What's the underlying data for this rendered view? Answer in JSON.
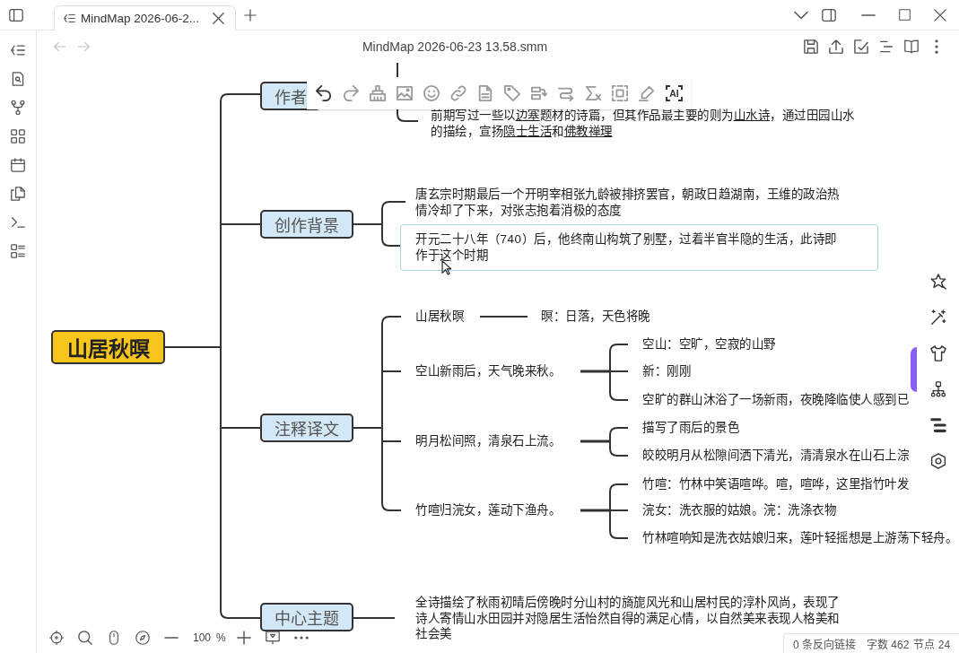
{
  "window": {
    "tabs": [
      {
        "title": "MindMap 2026-06-2...",
        "selected": true
      }
    ],
    "navigation": [
      {
        "kind": "back",
        "disabled": true
      },
      {
        "kind": "forward",
        "disabled": true
      }
    ],
    "document_title": "MindMap 2026-06-23 13.58.smm"
  },
  "mindmap": {
    "root": {
      "text": "山居秋暝",
      "children": [
        {
          "text": "作者",
          "children": [
            {
              "segments": [
                {
                  "text": "前期写过一些以",
                  "underlined": false
                },
                {
                  "text": "边塞",
                  "underlined": true
                },
                {
                  "text": "题材的诗篇，但其作品最主要的则为",
                  "underlined": false
                },
                {
                  "text": "山水诗",
                  "underlined": true
                },
                {
                  "text": "，通过田园山水的描绘，宣扬",
                  "underlined": false
                },
                {
                  "text": "隐士生活",
                  "underlined": true
                },
                {
                  "text": "和",
                  "underlined": false
                },
                {
                  "text": "佛教禅理",
                  "underlined": true
                }
              ]
            }
          ]
        },
        {
          "text": "创作背景",
          "children": [
            {
              "text": "唐玄宗时期最后一个开明宰相张九龄被排挤罢官，朝政日趋湖南，王维的政治热情冷却了下来，对张志抱着消极的态度",
              "hovered": false
            },
            {
              "text": "开元二十八年（740）后，他终南山构筑了别墅，过着半官半隐的生活，此诗即作于这个时期",
              "hovered": true
            }
          ]
        },
        {
          "text": "注释译文",
          "children": [
            {
              "text": "山居秋暝",
              "children": [
                {
                  "text": "暝：日落，天色将晚"
                }
              ]
            },
            {
              "text": "空山新雨后，天气晚来秋。",
              "children": [
                {
                  "text": "空山：空旷，空寂的山野"
                },
                {
                  "text": "新：刚刚"
                },
                {
                  "text": "空旷的群山沐浴了一场新雨，夜晚降临使人感到已"
                }
              ]
            },
            {
              "text": "明月松间照，清泉石上流。",
              "children": [
                {
                  "text": "描写了雨后的景色"
                },
                {
                  "text": "皎皎明月从松隙间洒下清光，清清泉水在山石上淙"
                }
              ]
            },
            {
              "text": "竹喧归浣女，莲动下渔舟。",
              "children": [
                {
                  "text": "竹喧：竹林中笑语喧哗。喧，喧哗，这里指竹叶发"
                },
                {
                  "text": "浣女：洗衣服的姑娘。浣：洗涤衣物"
                },
                {
                  "text": "竹林喧响知是洗衣姑娘归来，莲叶轻摇想是上游荡下轻舟。"
                }
              ]
            }
          ]
        },
        {
          "text": "中心主题",
          "children": [
            {
              "text": "全诗描绘了秋雨初晴后傍晚时分山村的旖旎风光和山居村民的淳朴风尚，表现了诗人寄情山水田园并对隐居生活怡然自得的满足心情，以自然美来表现人格美和社会美"
            }
          ]
        }
      ]
    }
  },
  "node_toolbar": [
    {
      "kind": "undo",
      "disabled": false
    },
    {
      "kind": "redo",
      "disabled": true
    },
    {
      "kind": "painter",
      "disabled": true
    },
    {
      "kind": "image",
      "disabled": true
    },
    {
      "kind": "emoji",
      "disabled": true
    },
    {
      "kind": "link",
      "disabled": true
    },
    {
      "kind": "note",
      "disabled": true
    },
    {
      "kind": "tag",
      "disabled": true
    },
    {
      "kind": "summary",
      "disabled": true
    },
    {
      "kind": "association",
      "disabled": true
    },
    {
      "kind": "formula",
      "disabled": true
    },
    {
      "kind": "frame",
      "disabled": true
    },
    {
      "kind": "marker",
      "disabled": true
    },
    {
      "kind": "ai",
      "label": "AI",
      "disabled": false
    }
  ],
  "zoom_bar": {
    "zoom": "100",
    "unit": "%"
  },
  "status_bar": {
    "backlinks": "0 条反向链接",
    "word_count": "字数 462",
    "node_count": "节点 24"
  }
}
